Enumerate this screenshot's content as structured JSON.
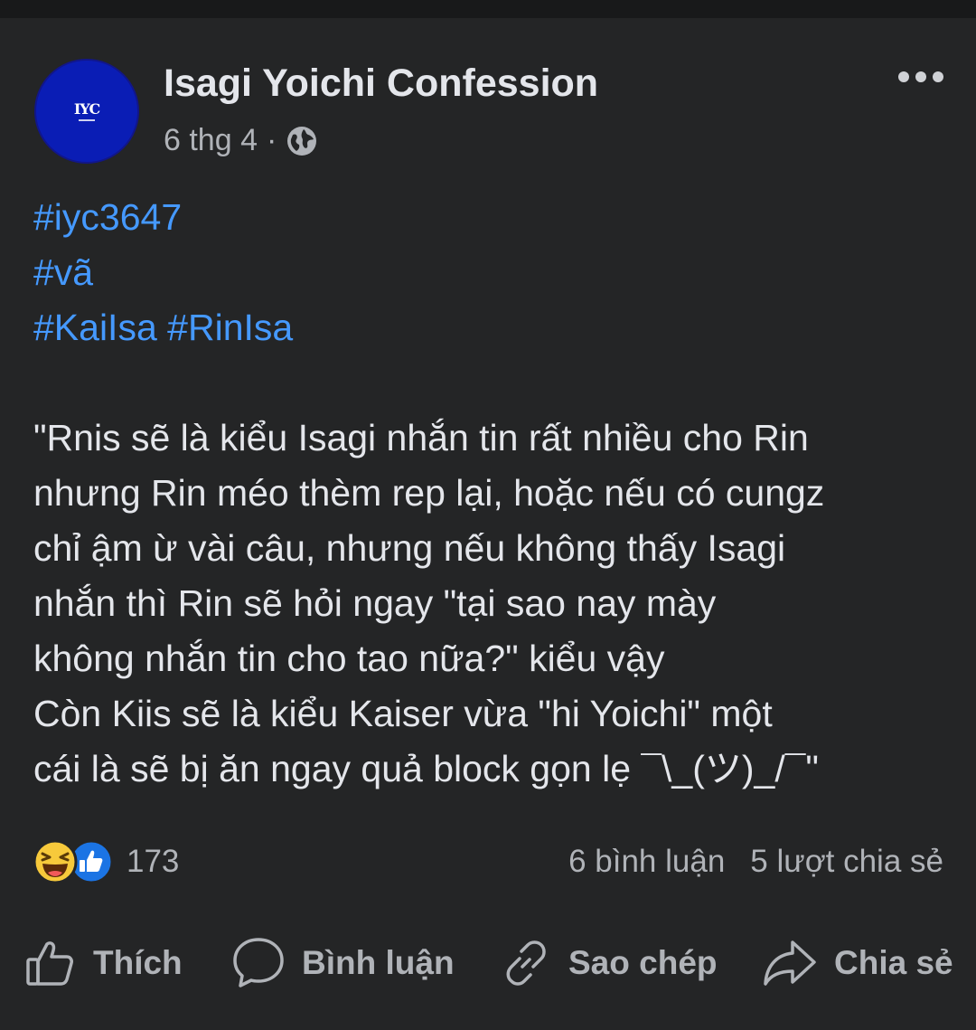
{
  "post": {
    "page_name": "Isagi Yoichi Confession",
    "avatar_text": "IYC",
    "date": "6 thg 4",
    "separator": "·",
    "privacy_icon": "globe-icon",
    "more_icon": "more-dots-icon",
    "hashtags": {
      "line1": "#iyc3647",
      "line2": "#vã",
      "line3_a": "#KaiIsa",
      "line3_b": "#RinIsa"
    },
    "body_lines": [
      "\"Rnis sẽ là kiểu Isagi nhắn tin rất nhiều cho Rin",
      "nhưng Rin méo thèm rep lại, hoặc nếu có cungz",
      "chỉ ậm ừ vài câu, nhưng nếu không thấy Isagi",
      "nhắn thì Rin sẽ hỏi ngay \"tại sao nay mày",
      "không nhắn tin cho tao nữa?\" kiểu vậy",
      "Còn Kiis sẽ là kiểu Kaiser vừa \"hi Yoichi\" một",
      "cái là sẽ bị ăn ngay quả block gọn lẹ ¯\\_(ツ)_/¯\""
    ]
  },
  "stats": {
    "reaction_icons": [
      "haha-reaction-icon",
      "like-reaction-icon"
    ],
    "reaction_count": "173",
    "comments": "6 bình luận",
    "shares": "5 lượt chia sẻ"
  },
  "actions": {
    "like": {
      "label": "Thích",
      "icon": "thumbs-up-icon"
    },
    "comment": {
      "label": "Bình luận",
      "icon": "comment-bubble-icon"
    },
    "copy": {
      "label": "Sao chép",
      "icon": "link-icon"
    },
    "share": {
      "label": "Chia sẻ",
      "icon": "share-arrow-icon"
    }
  },
  "colors": {
    "background": "#242526",
    "text": "#e4e6eb",
    "secondary_text": "#b0b3b8",
    "hashtag": "#4599ff",
    "avatar": "#0a1db5"
  }
}
